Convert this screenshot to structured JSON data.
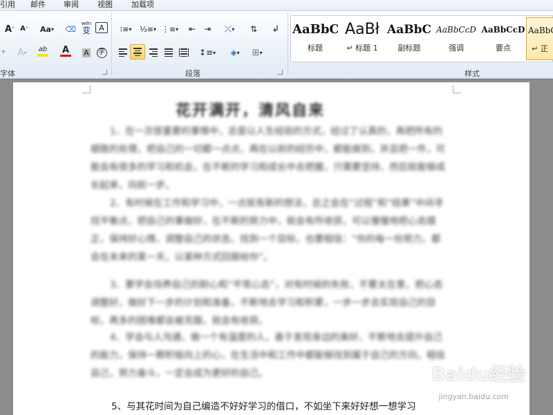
{
  "tabs": [
    "引用",
    "邮件",
    "审阅",
    "视图",
    "加载项"
  ],
  "font_group": {
    "label": "字体",
    "size_up": "A",
    "size_down": "A",
    "change_case": "Aa",
    "pinyin": "wén",
    "pinyin_char": "变",
    "border_char": "A",
    "highlight_letter": "ab",
    "font_color_letter": "A",
    "shade_char": "A",
    "circle_char": "字"
  },
  "paragraph_group": {
    "label": "段落"
  },
  "styles_group": {
    "label": "样式",
    "items": [
      {
        "sample": "AaBbC",
        "name": "标题"
      },
      {
        "sample": "AaBł",
        "name": "标题 1"
      },
      {
        "sample": "AaBbC",
        "name": "副标题"
      },
      {
        "sample": "AaBbCcD",
        "name": "强调"
      },
      {
        "sample": "AaBbCcD",
        "name": "要点"
      },
      {
        "sample": "AaBbC",
        "name": "正"
      }
    ]
  },
  "document": {
    "title": "花开满开，清风自来",
    "paragraphs": [
      "1、在一次很重要的事情中，总是以人生经验的方式，经过了认真的，再把所有的细致的处理，把自己的一切都一点点，再在以前的经历中，都能做到，并且把一件，可能会有很多的学习和机会，在不断的学习和成长中去把握，只需要坚持，然后就能够成长起来，向前一步。",
      "2、有时候在工作和学习中，一点就有新的想法，总之会在“过程”和“结果”中间寻找平衡点，把自己的事做好，在不断的努力中，就会有所收获，可以慢慢地把心态摆正，保持好心情，调整自己的状态，找到一个目标，也要相信：“你的每一份努力，都会在未来的某一天，以某种方式回报给你”。",
      "3、要学会培养自己的耐心和“平常心态”，对有时候的失败，不要太在意，把心态调整好，做好下一步的计划和准备，不断地去学习和积累，一步一步去实现自己的目标，再多的困难都会被克服，就会有收获。",
      "4、学会与人沟通，做一个有温度的人，善于发现身边的美好，不断地去提升自己的能力，保持一颗积极向上的心，在生活中和工作中都能够找到属于自己的方向，相信自己，努力奋斗，一定会成为更好的自己。",
      "5、与其花时间为自己编造不好好学习的借口，不如坐下来好好想一想学习"
    ]
  },
  "watermark": {
    "text": "Baidu经验",
    "url": "jingyan.baidu.com"
  }
}
